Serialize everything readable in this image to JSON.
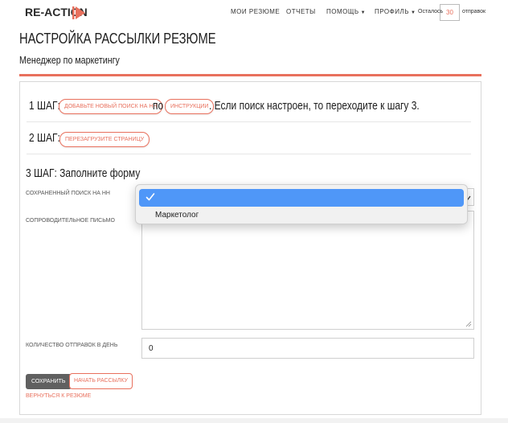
{
  "brand": {
    "name": "RE-ACTION",
    "accent_color": "#e8705d"
  },
  "nav": {
    "items": [
      {
        "label": "МОИ РЕЗЮМЕ",
        "has_caret": false
      },
      {
        "label": "ОТЧЕТЫ",
        "has_caret": false
      },
      {
        "label": "ПОМОЩЬ",
        "has_caret": true
      },
      {
        "label": "ПРОФИЛЬ",
        "has_caret": true
      }
    ],
    "remaining_prefix": "Осталось",
    "remaining_value": "30",
    "remaining_suffix": "отправок"
  },
  "page": {
    "title": "НАСТРОЙКА РАССЫЛКИ РЕЗЮМЕ",
    "subtitle": "Менеджер по маркетингу"
  },
  "steps": {
    "step1": {
      "label": "1 ШАГ:",
      "add_search_button": "ДОБАВЬТЕ НОВЫЙ ПОИСК НА HH",
      "by_text": "по",
      "instructions_button": "ИНСТРУКЦИИ",
      "tail_text": ". Если поиск настроен, то переходите к шагу 3."
    },
    "step2": {
      "label": "2 ШАГ:",
      "reload_button": "ПЕРЕЗАГРУЗИТЕ СТРАНИЦУ"
    },
    "step3": {
      "label": "3 ШАГ: Заполните форму"
    }
  },
  "form": {
    "saved_search_label": "СОХРАНЕННЫЙ ПОИСК НА HH",
    "saved_search_options": [
      "",
      "Маркетолог"
    ],
    "saved_search_selected": "",
    "cover_letter_label": "СОПРОВОДИТЕЛЬНОЕ ПИСЬМО",
    "cover_letter_value": "",
    "daily_count_label": "КОЛИЧЕСТВО ОТПРАВОК В ДЕНЬ",
    "daily_count_value": "0",
    "save_button": "СОХРАНИТЬ",
    "start_button": "НАЧАТЬ РАССЫЛКУ",
    "back_link": "ВЕРНУТЬСЯ К РЕЗЮМЕ"
  },
  "dropdown": {
    "selected_icon": "checkmark-icon",
    "highlight_color": "#4f97f8",
    "option_label": "Маркетолог"
  }
}
